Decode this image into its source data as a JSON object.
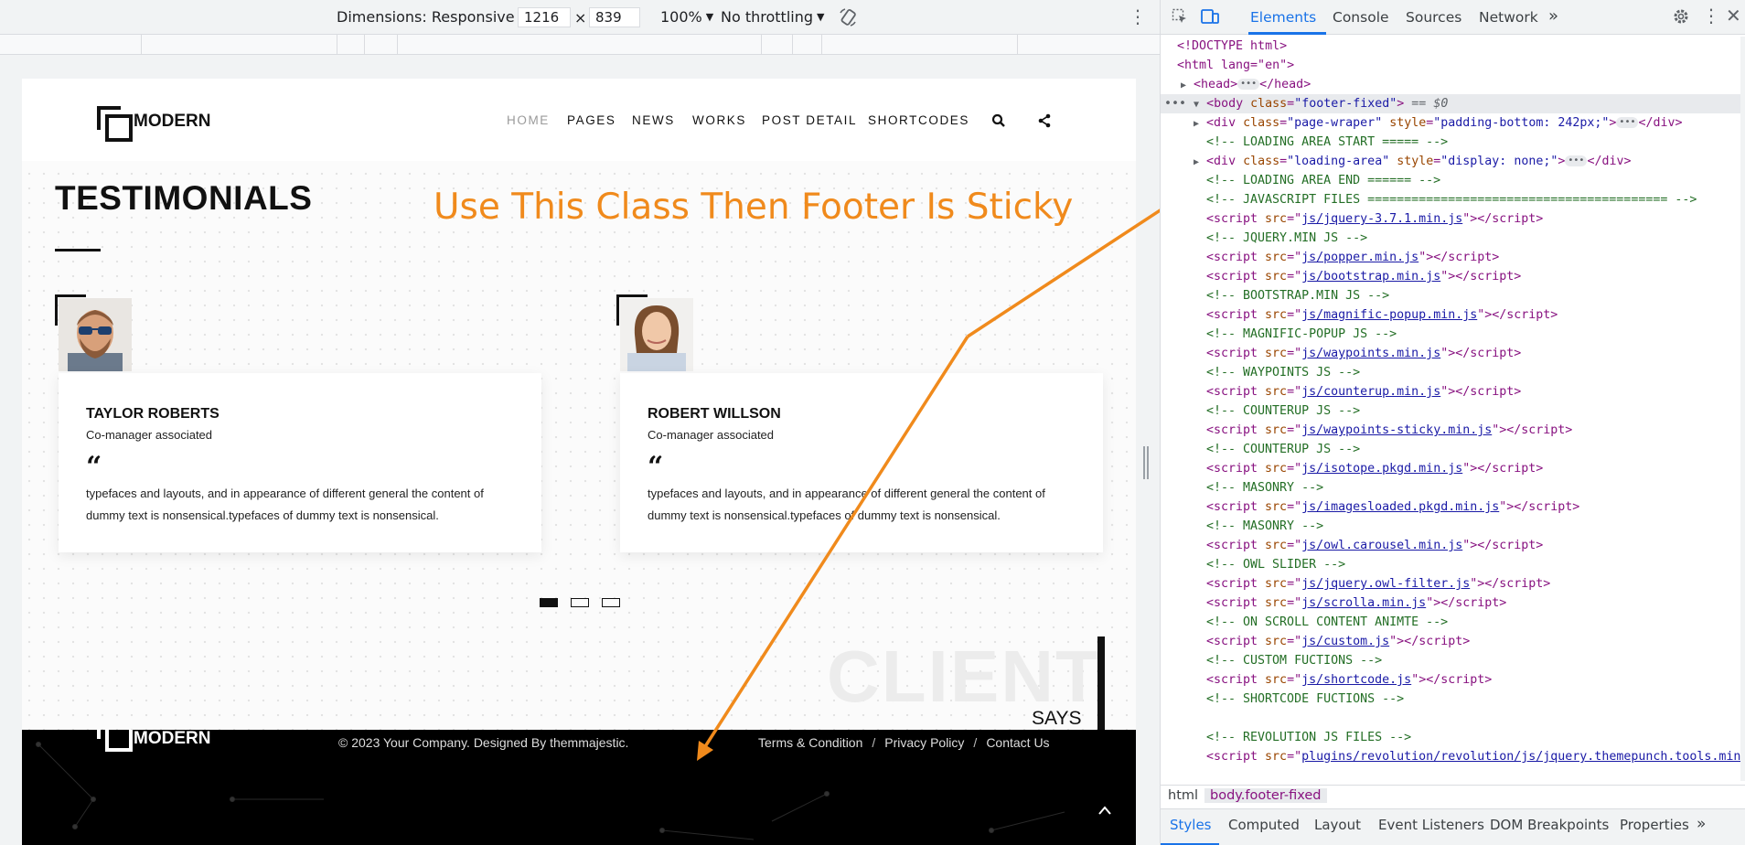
{
  "device_toolbar": {
    "dimensions_label": "Dimensions: Responsive",
    "width_value": "1216",
    "times": "×",
    "height_value": "839",
    "zoom_label": "100%",
    "throttle_label": "No throttling"
  },
  "site": {
    "logo_text": "MODERN",
    "nav": [
      "HOME",
      "PAGES",
      "NEWS",
      "WORKS",
      "POST DETAIL",
      "SHORTCODES"
    ],
    "section_title": "TESTIMONIALS",
    "annotation": "Use This Class Then Footer Is Sticky",
    "testimonials": [
      {
        "name": "TAYLOR ROBERTS",
        "role": "Co-manager associated",
        "text": "typefaces and layouts, and in appearance of different general the content of dummy text is nonsensical.typefaces of dummy text is nonsensical."
      },
      {
        "name": "ROBERT WILLSON",
        "role": "Co-manager associated",
        "text": "typefaces and layouts, and in appearance of different general the content of dummy text is nonsensical.typefaces of dummy text is nonsensical."
      }
    ],
    "client_big": "CLIENT",
    "client_says": "SAYS",
    "footer": {
      "logo_text": "MODERN",
      "copyright": "© 2023 Your Company. Designed By themmajestic.",
      "links": [
        "Terms & Condition",
        "Privacy Policy",
        "Contact Us"
      ],
      "separator": "/"
    },
    "annotation_color": "#f08a1c"
  },
  "devtools": {
    "tabs": [
      "Elements",
      "Console",
      "Sources",
      "Network"
    ],
    "more_tabs": "»",
    "breadcrumbs": [
      "html",
      "body.footer-fixed"
    ],
    "sub_tabs": [
      "Styles",
      "Computed",
      "Layout",
      "Event Listeners",
      "DOM Breakpoints",
      "Properties"
    ],
    "tree": {
      "doctype": "<!DOCTYPE html>",
      "html_open": "<html lang=\"en\">",
      "head": "<head>",
      "head_close": "</head>",
      "body_tag": "<body",
      "body_attr": "class",
      "body_class": "\"footer-fixed\"",
      "body_eq": "== $0",
      "wrapper_attr1": "class",
      "wrapper_val1": "\"page-wraper\"",
      "wrapper_attr2": "style",
      "wrapper_val2": "\"padding-bottom: 242px;\"",
      "loading_attr2_val": "\"display: none;\"",
      "loading_val1": "\"loading-area\"",
      "comments": [
        "<!-- LOADING AREA START ===== -->",
        "<!-- LOADING AREA  END ====== -->",
        "<!-- JAVASCRIPT  FILES ========================================= -->"
      ],
      "scripts": [
        {
          "src": "js/jquery-3.7.1.min.js",
          "comment": "<!-- JQUERY.MIN JS -->"
        },
        {
          "src": "js/popper.min.js",
          "comment": ""
        },
        {
          "src": "js/bootstrap.min.js",
          "comment": "<!-- BOOTSTRAP.MIN JS -->"
        },
        {
          "src": "js/magnific-popup.min.js",
          "comment": "<!-- MAGNIFIC-POPUP JS -->"
        },
        {
          "src": "js/waypoints.min.js",
          "comment": "<!-- WAYPOINTS JS -->"
        },
        {
          "src": "js/counterup.min.js",
          "comment": "<!-- COUNTERUP JS -->"
        },
        {
          "src": "js/waypoints-sticky.min.js",
          "comment": "<!-- COUNTERUP JS -->"
        },
        {
          "src": "js/isotope.pkgd.min.js",
          "comment": "<!-- MASONRY  -->"
        },
        {
          "src": "js/imagesloaded.pkgd.min.js",
          "comment": "<!-- MASONRY  -->"
        },
        {
          "src": "js/owl.carousel.min.js",
          "comment": "<!-- OWL  SLIDER  -->"
        },
        {
          "src": "js/jquery.owl-filter.js",
          "comment": ""
        },
        {
          "src": "js/scrolla.min.js",
          "comment": "<!-- ON SCROLL CONTENT ANIMTE   -->"
        },
        {
          "src": "js/custom.js",
          "comment": "<!-- CUSTOM FUCTIONS  -->"
        },
        {
          "src": "js/shortcode.js",
          "comment": "<!-- SHORTCODE FUCTIONS  -->"
        }
      ],
      "rev_comment": "<!-- REVOLUTION JS FILES -->",
      "rev_src": "plugins/revolution/revolution/js/jquery.themepunch.tools.min.js"
    }
  }
}
